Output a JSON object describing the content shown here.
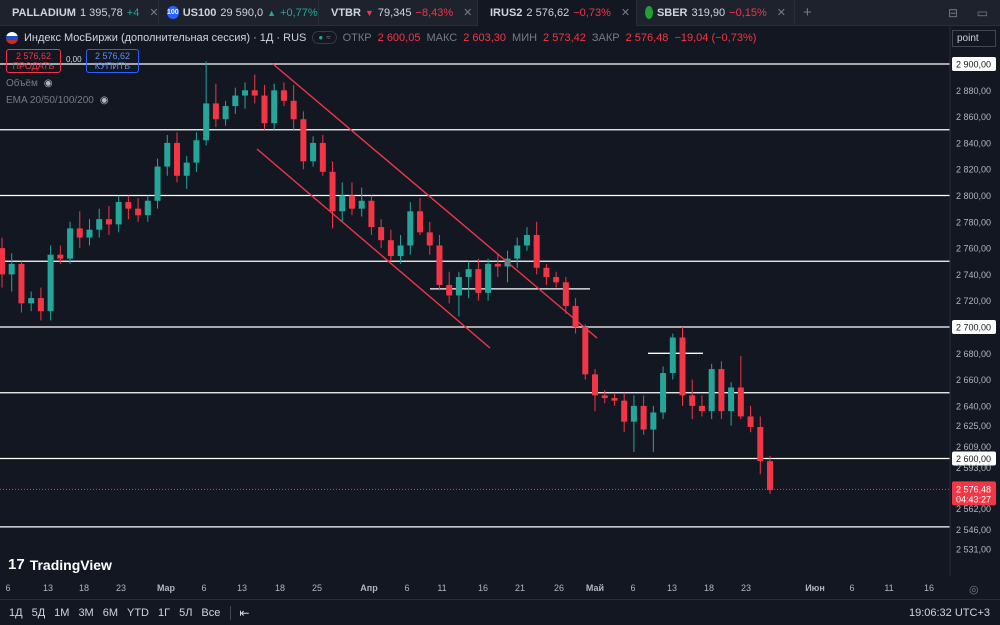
{
  "tabs": [
    {
      "symbol": "PALLADIUM",
      "price": "1 395,78",
      "change": "+4",
      "dir": "up",
      "badge": "",
      "badge_color": "#b2b5be",
      "active": false
    },
    {
      "symbol": "US100",
      "price": "29 590,0",
      "change": "+0,77%",
      "dir": "up",
      "badge": "100",
      "badge_color": "#2962ff",
      "active": false
    },
    {
      "symbol": "VTBR",
      "price": "79,345",
      "change": "−8,43%",
      "dir": "down",
      "badge": "",
      "badge_color": "#1e50c8",
      "active": false
    },
    {
      "symbol": "IRUS2",
      "price": "2 576,62",
      "change": "−0,73%",
      "dir": "down",
      "badge": "",
      "badge_color": "#d52b1e",
      "active": true
    },
    {
      "symbol": "SBER",
      "price": "319,90",
      "change": "−0,15%",
      "dir": "down",
      "badge": "",
      "badge_color": "#21a038",
      "active": false
    }
  ],
  "legend": {
    "title": "Индекс МосБиржи (дополнительная сессия) · 1Д · RUS",
    "open_label": "ОТКР",
    "open": "2 600,05",
    "high_label": "МАКС",
    "high": "2 603,30",
    "low_label": "МИН",
    "low": "2 573,42",
    "close_label": "ЗАКР",
    "close": "2 576,48",
    "change": "−19,04 (−0,73%)"
  },
  "trade": {
    "sell_price": "2 576,62",
    "sell_label": "ПРОДАТЬ",
    "spread": "0,00",
    "buy_price": "2 576,62",
    "buy_label": "КУПИТЬ"
  },
  "indicators": {
    "volume": "Объём",
    "ema": "EMA 20/50/100/200"
  },
  "point_input": "point",
  "logo": "TradingView",
  "bottombar": {
    "ranges": [
      "1Д",
      "5Д",
      "1М",
      "3М",
      "6М",
      "YTD",
      "1Г",
      "5Л",
      "Все"
    ],
    "time": "19:06:32 UTC+3"
  },
  "colors": {
    "up": "#26a69a",
    "down": "#f23645",
    "bg": "#131722",
    "grid": "#2a2e39",
    "level": "#ffffff",
    "channel": "#f23645"
  },
  "chart_data": {
    "type": "candlestick",
    "price_axis_ticks": [
      "2 900,00",
      "2 880,00",
      "2 860,00",
      "2 840,00",
      "2 820,00",
      "2 800,00",
      "2 780,00",
      "2 760,00",
      "2 740,00",
      "2 720,00",
      "2 700,00",
      "2 680,00",
      "2 660,00",
      "2 640,00",
      "2 625,00",
      "2 609,00",
      "2 600,00",
      "2 593,00",
      "2 576,48",
      "2 562,00",
      "2 546,00",
      "2 531,00"
    ],
    "price_axis_values": [
      2900,
      2880,
      2860,
      2840,
      2820,
      2800,
      2780,
      2760,
      2740,
      2720,
      2700,
      2680,
      2660,
      2640,
      2625,
      2609,
      2600,
      2593,
      2576.48,
      2562,
      2546,
      2531
    ],
    "highlighted_ticks": [
      "2 900,00",
      "2 700,00",
      "2 600,00"
    ],
    "current_price": "2 576,48",
    "countdown": "04:43:27",
    "time_axis": [
      "6",
      "13",
      "18",
      "23",
      "Мар",
      "6",
      "13",
      "18",
      "25",
      "Апр",
      "6",
      "11",
      "16",
      "21",
      "26",
      "Май",
      "6",
      "13",
      "18",
      "23",
      "Июн",
      "6",
      "11",
      "16"
    ],
    "horizontal_levels": [
      2900,
      2850,
      2800,
      2750,
      2700,
      2650,
      2600,
      2548
    ],
    "short_levels": [
      {
        "price": 2729,
        "from": "Апр 11",
        "to": "Апр 26"
      },
      {
        "price": 2680,
        "from": "Май 10",
        "to": "Май 18"
      }
    ],
    "channel_lines": [
      {
        "from": [
          17,
          2900
        ],
        "to": [
          58,
          2700
        ]
      },
      {
        "from": [
          15,
          2832
        ],
        "to": [
          56,
          2642
        ]
      }
    ],
    "candles": [
      [
        2760,
        2768,
        2730,
        2740
      ],
      [
        2740,
        2756,
        2727,
        2748
      ],
      [
        2748,
        2750,
        2711,
        2718
      ],
      [
        2718,
        2727,
        2712,
        2722
      ],
      [
        2722,
        2730,
        2705,
        2712
      ],
      [
        2712,
        2762,
        2705,
        2755
      ],
      [
        2755,
        2762,
        2748,
        2752
      ],
      [
        2752,
        2780,
        2748,
        2775
      ],
      [
        2775,
        2788,
        2760,
        2768
      ],
      [
        2768,
        2782,
        2762,
        2774
      ],
      [
        2774,
        2790,
        2768,
        2782
      ],
      [
        2782,
        2792,
        2770,
        2778
      ],
      [
        2778,
        2800,
        2772,
        2795
      ],
      [
        2795,
        2800,
        2782,
        2790
      ],
      [
        2790,
        2798,
        2780,
        2785
      ],
      [
        2785,
        2800,
        2780,
        2796
      ],
      [
        2796,
        2828,
        2790,
        2822
      ],
      [
        2822,
        2846,
        2815,
        2840
      ],
      [
        2840,
        2848,
        2810,
        2815
      ],
      [
        2815,
        2830,
        2805,
        2825
      ],
      [
        2825,
        2848,
        2818,
        2842
      ],
      [
        2842,
        2902,
        2838,
        2870
      ],
      [
        2870,
        2885,
        2852,
        2858
      ],
      [
        2858,
        2872,
        2853,
        2868
      ],
      [
        2868,
        2882,
        2862,
        2876
      ],
      [
        2876,
        2886,
        2866,
        2880
      ],
      [
        2880,
        2892,
        2870,
        2876
      ],
      [
        2876,
        2884,
        2850,
        2855
      ],
      [
        2855,
        2885,
        2850,
        2880
      ],
      [
        2880,
        2886,
        2868,
        2872
      ],
      [
        2872,
        2884,
        2850,
        2858
      ],
      [
        2858,
        2864,
        2820,
        2826
      ],
      [
        2826,
        2845,
        2822,
        2840
      ],
      [
        2840,
        2846,
        2815,
        2818
      ],
      [
        2818,
        2826,
        2775,
        2788
      ],
      [
        2788,
        2810,
        2780,
        2800
      ],
      [
        2800,
        2810,
        2785,
        2790
      ],
      [
        2790,
        2806,
        2784,
        2796
      ],
      [
        2796,
        2800,
        2770,
        2776
      ],
      [
        2776,
        2782,
        2760,
        2766
      ],
      [
        2766,
        2774,
        2750,
        2754
      ],
      [
        2754,
        2770,
        2748,
        2762
      ],
      [
        2762,
        2795,
        2755,
        2788
      ],
      [
        2788,
        2798,
        2770,
        2772
      ],
      [
        2772,
        2780,
        2755,
        2762
      ],
      [
        2762,
        2770,
        2728,
        2732
      ],
      [
        2732,
        2742,
        2718,
        2724
      ],
      [
        2724,
        2742,
        2708,
        2738
      ],
      [
        2738,
        2750,
        2722,
        2744
      ],
      [
        2744,
        2752,
        2720,
        2726
      ],
      [
        2726,
        2752,
        2720,
        2748
      ],
      [
        2748,
        2756,
        2738,
        2746
      ],
      [
        2746,
        2758,
        2734,
        2752
      ],
      [
        2752,
        2768,
        2745,
        2762
      ],
      [
        2762,
        2776,
        2758,
        2770
      ],
      [
        2770,
        2780,
        2740,
        2745
      ],
      [
        2745,
        2748,
        2732,
        2738
      ],
      [
        2738,
        2742,
        2730,
        2734
      ],
      [
        2734,
        2738,
        2710,
        2716
      ],
      [
        2716,
        2722,
        2695,
        2700
      ],
      [
        2700,
        2702,
        2660,
        2664
      ],
      [
        2664,
        2668,
        2636,
        2648
      ],
      [
        2648,
        2652,
        2642,
        2646
      ],
      [
        2646,
        2650,
        2640,
        2644
      ],
      [
        2644,
        2650,
        2620,
        2628
      ],
      [
        2628,
        2648,
        2605,
        2640
      ],
      [
        2640,
        2648,
        2618,
        2622
      ],
      [
        2622,
        2640,
        2605,
        2635
      ],
      [
        2635,
        2670,
        2630,
        2665
      ],
      [
        2665,
        2695,
        2660,
        2692
      ],
      [
        2692,
        2700,
        2640,
        2648
      ],
      [
        2648,
        2660,
        2630,
        2640
      ],
      [
        2640,
        2648,
        2632,
        2636
      ],
      [
        2636,
        2672,
        2630,
        2668
      ],
      [
        2668,
        2674,
        2630,
        2636
      ],
      [
        2636,
        2658,
        2625,
        2654
      ],
      [
        2654,
        2678,
        2630,
        2632
      ],
      [
        2632,
        2640,
        2620,
        2624
      ],
      [
        2624,
        2632,
        2588,
        2598
      ],
      [
        2598,
        2602,
        2573,
        2576
      ]
    ]
  }
}
